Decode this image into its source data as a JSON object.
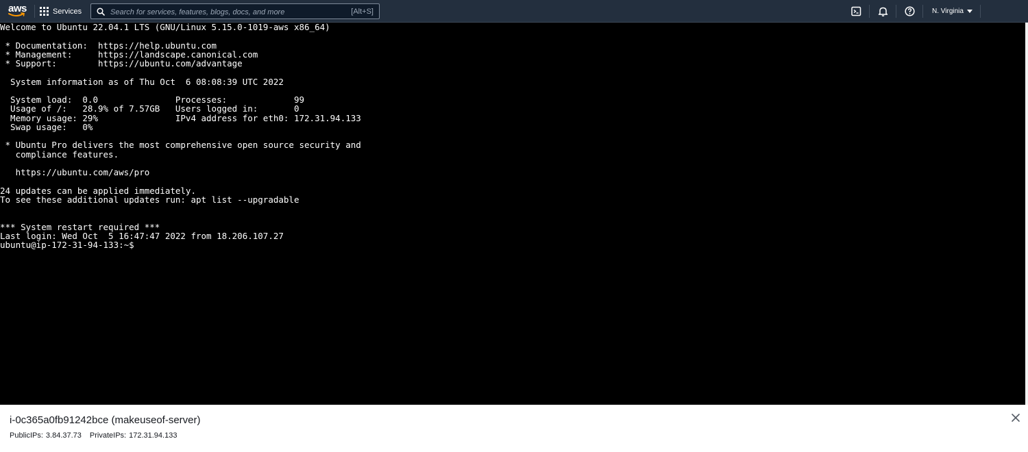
{
  "header": {
    "logo_text": "aws",
    "services_label": "Services",
    "search": {
      "placeholder": "Search for services, features, blogs, docs, and more",
      "value": "",
      "shortcut": "[Alt+S]"
    },
    "icons": [
      "cloudshell-icon",
      "bell-icon",
      "help-icon"
    ],
    "region_label": "N. Virginia"
  },
  "terminal": {
    "lines": [
      "Welcome to Ubuntu 22.04.1 LTS (GNU/Linux 5.15.0-1019-aws x86_64)",
      "",
      " * Documentation:  https://help.ubuntu.com",
      " * Management:     https://landscape.canonical.com",
      " * Support:        https://ubuntu.com/advantage",
      "",
      "  System information as of Thu Oct  6 08:08:39 UTC 2022",
      "",
      "  System load:  0.0               Processes:             99",
      "  Usage of /:   28.9% of 7.57GB   Users logged in:       0",
      "  Memory usage: 29%               IPv4 address for eth0: 172.31.94.133",
      "  Swap usage:   0%",
      "",
      " * Ubuntu Pro delivers the most comprehensive open source security and",
      "   compliance features.",
      "",
      "   https://ubuntu.com/aws/pro",
      "",
      "24 updates can be applied immediately.",
      "To see these additional updates run: apt list --upgradable",
      "",
      "",
      "*** System restart required ***",
      "Last login: Wed Oct  5 16:47:47 2022 from 18.206.107.27",
      "ubuntu@ip-172-31-94-133:~$"
    ]
  },
  "footer": {
    "instance_title": "i-0c365a0fb91242bce (makeuseof-server)",
    "public_ips_label": "PublicIPs:",
    "public_ips_value": "3.84.37.73",
    "private_ips_label": "PrivateIPs:",
    "private_ips_value": "172.31.94.133"
  },
  "colors": {
    "nav_bg": "#232f3e",
    "terminal_bg": "#000000",
    "terminal_fg": "#ffffff",
    "search_border": "#7d8998"
  }
}
